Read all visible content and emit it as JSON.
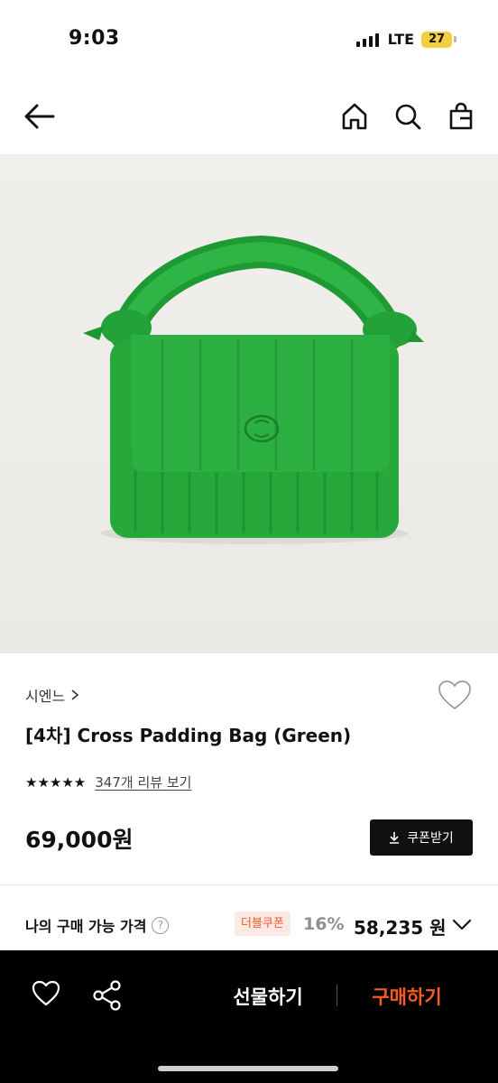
{
  "status_bar": {
    "time": "9:03",
    "network": "LTE",
    "battery": "27"
  },
  "product": {
    "brand": "시엔느",
    "title": "[4차] Cross Padding Bag (Green)",
    "rating_stars": "★★★★★",
    "review_link": "347개 리뷰 보기",
    "price": "69,000원",
    "coupon_button": "쿠폰받기",
    "my_price_label": "나의 구매 가능 가격",
    "help_symbol": "?",
    "double_coupon_badge": "더블쿠폰",
    "discount_rate": "16%",
    "final_price": "58,235 원"
  },
  "bottom_bar": {
    "gift_label": "선물하기",
    "buy_label": "구매하기"
  },
  "colors": {
    "bag_green": "#26a83a",
    "buy_accent": "#ff5a1f",
    "badge_text": "#f05a28",
    "battery": "#f2cf3e"
  },
  "icons": [
    "back-arrow-icon",
    "home-icon",
    "search-icon",
    "shopping-bag-icon",
    "heart-icon",
    "share-icon",
    "chevron-down-icon",
    "download-icon",
    "star-icon"
  ]
}
